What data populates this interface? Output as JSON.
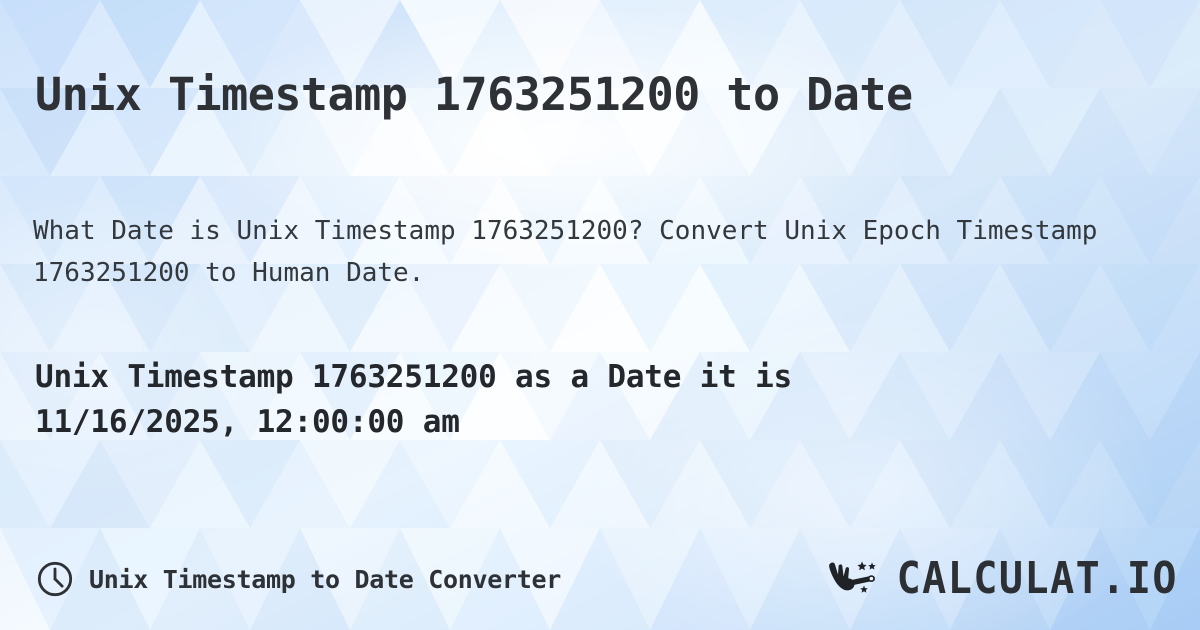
{
  "page": {
    "title": "Unix Timestamp 1763251200 to Date",
    "description": "What Date is Unix Timestamp 1763251200? Convert Unix Epoch Timestamp 1763251200 to Human Date.",
    "result_line1": "Unix Timestamp 1763251200 as a Date it is",
    "result_line2": "11/16/2025, 12:00:00 am"
  },
  "timestamp": {
    "value": "1763251200",
    "human_date": "11/16/2025, 12:00:00 am"
  },
  "footer": {
    "label": "Unix Timestamp to Date Converter",
    "clock_icon": "clock-icon",
    "brand_mark_icon": "magic-wand-hand-icon",
    "brand_name": "CALCULAT.IO"
  },
  "colors": {
    "text_dark": "#2e3135",
    "text_body": "#33383d",
    "bg_light": "#f4fafe",
    "bg_blue": "#bdd9f8",
    "accent_blue": "#9ecbf5"
  }
}
